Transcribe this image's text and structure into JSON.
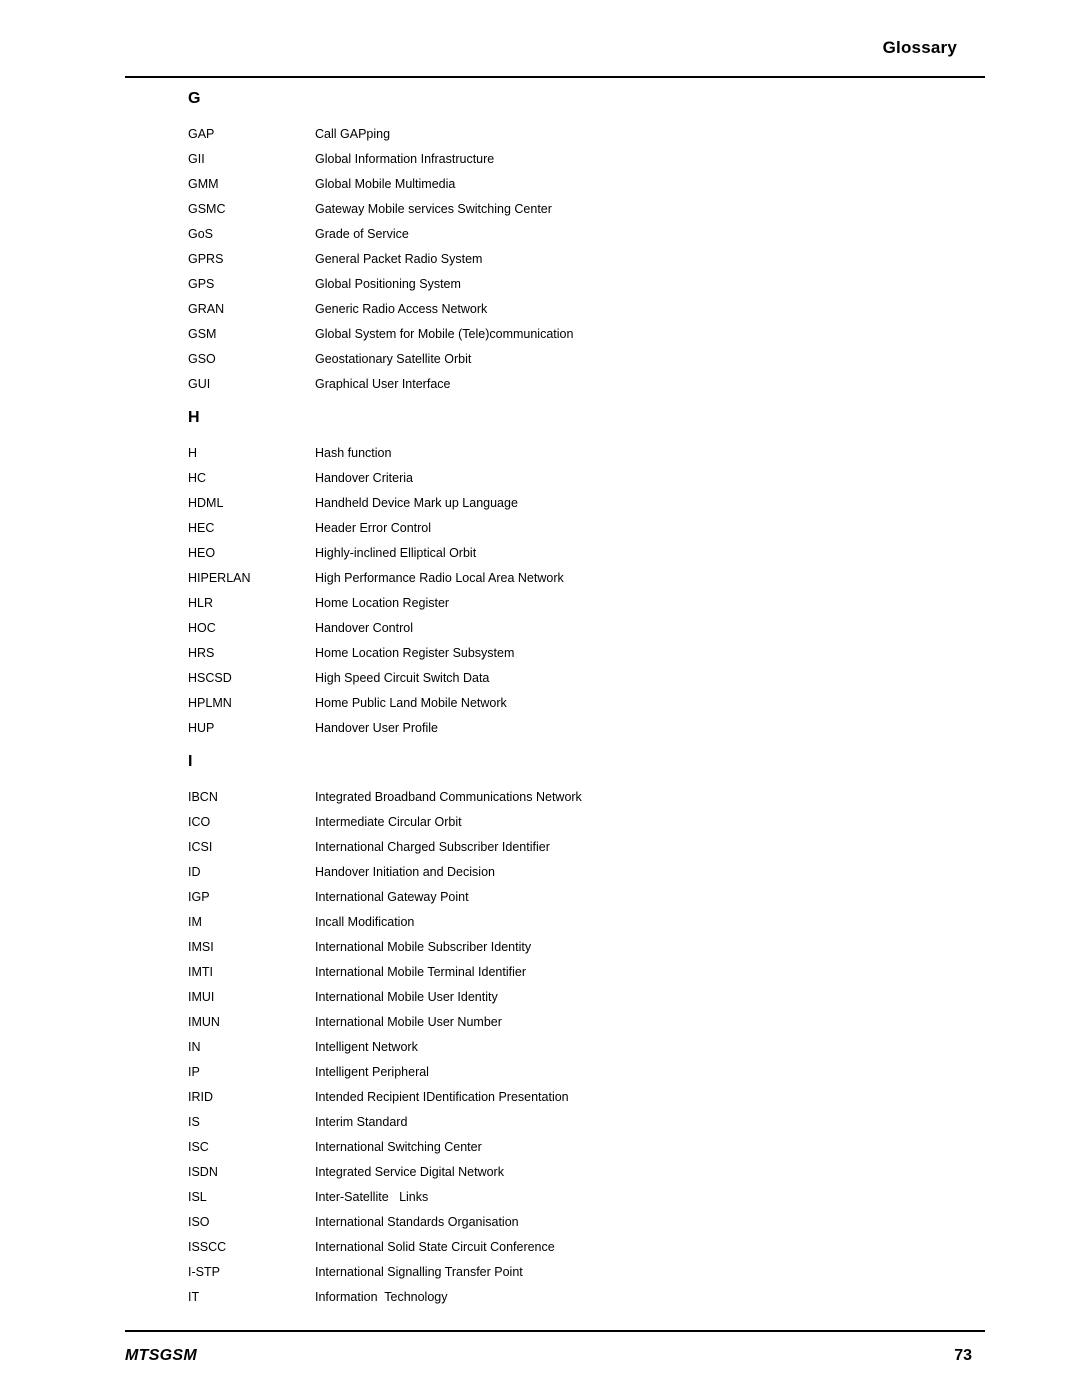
{
  "header": {
    "title": "Glossary"
  },
  "footer": {
    "document_name": "MTSGSM",
    "page_number": "73"
  },
  "sections": [
    {
      "heading": "G",
      "entries": [
        {
          "term": "GAP",
          "definition": "Call GAPping"
        },
        {
          "term": "GII",
          "definition": "Global Information Infrastructure"
        },
        {
          "term": "GMM",
          "definition": "Global Mobile Multimedia"
        },
        {
          "term": "GSMC",
          "definition": "Gateway Mobile services Switching Center"
        },
        {
          "term": "GoS",
          "definition": "Grade of Service"
        },
        {
          "term": "GPRS",
          "definition": "General Packet Radio System"
        },
        {
          "term": "GPS",
          "definition": "Global Positioning System"
        },
        {
          "term": "GRAN",
          "definition": "Generic Radio Access Network"
        },
        {
          "term": "GSM",
          "definition": "Global System for Mobile (Tele)communication"
        },
        {
          "term": "GSO",
          "definition": "Geostationary Satellite Orbit"
        },
        {
          "term": "GUI",
          "definition": "Graphical User Interface"
        }
      ]
    },
    {
      "heading": "H",
      "entries": [
        {
          "term": "H",
          "definition": "Hash function"
        },
        {
          "term": "HC",
          "definition": "Handover Criteria"
        },
        {
          "term": "HDML",
          "definition": "Handheld Device Mark up Language"
        },
        {
          "term": "HEC",
          "definition": "Header Error Control"
        },
        {
          "term": "HEO",
          "definition": "Highly-inclined Elliptical Orbit"
        },
        {
          "term": "HIPERLAN",
          "definition": "High Performance Radio Local Area Network"
        },
        {
          "term": "HLR",
          "definition": "Home Location Register"
        },
        {
          "term": "HOC",
          "definition": "Handover Control"
        },
        {
          "term": "HRS",
          "definition": "Home Location Register Subsystem"
        },
        {
          "term": "HSCSD",
          "definition": "High Speed Circuit Switch Data"
        },
        {
          "term": "HPLMN",
          "definition": "Home Public Land Mobile Network"
        },
        {
          "term": "HUP",
          "definition": "Handover User Profile"
        }
      ]
    },
    {
      "heading": "I",
      "entries": [
        {
          "term": "IBCN",
          "definition": "Integrated Broadband Communications Network"
        },
        {
          "term": "ICO",
          "definition": "Intermediate Circular Orbit"
        },
        {
          "term": "ICSI",
          "definition": "International Charged Subscriber Identifier"
        },
        {
          "term": "ID",
          "definition": "Handover Initiation and Decision"
        },
        {
          "term": "IGP",
          "definition": "International Gateway Point"
        },
        {
          "term": "IM",
          "definition": "Incall Modification"
        },
        {
          "term": "IMSI",
          "definition": "International Mobile Subscriber Identity"
        },
        {
          "term": "IMTI",
          "definition": "International Mobile Terminal Identifier"
        },
        {
          "term": "IMUI",
          "definition": "International Mobile User Identity"
        },
        {
          "term": "IMUN",
          "definition": "International Mobile User Number"
        },
        {
          "term": "IN",
          "definition": "Intelligent Network"
        },
        {
          "term": "IP",
          "definition": "Intelligent Peripheral"
        },
        {
          "term": "IRID",
          "definition": "Intended Recipient IDentification Presentation"
        },
        {
          "term": "IS",
          "definition": "Interim Standard"
        },
        {
          "term": "ISC",
          "definition": "International Switching Center"
        },
        {
          "term": "ISDN",
          "definition": "Integrated Service Digital Network"
        },
        {
          "term": "ISL",
          "definition": "Inter-Satellite   Links"
        },
        {
          "term": "ISO",
          "definition": "International Standards Organisation"
        },
        {
          "term": "ISSCC",
          "definition": "International Solid State Circuit Conference"
        },
        {
          "term": "I-STP",
          "definition": "International Signalling Transfer Point"
        },
        {
          "term": "IT",
          "definition": "Information  Technology"
        }
      ]
    }
  ]
}
